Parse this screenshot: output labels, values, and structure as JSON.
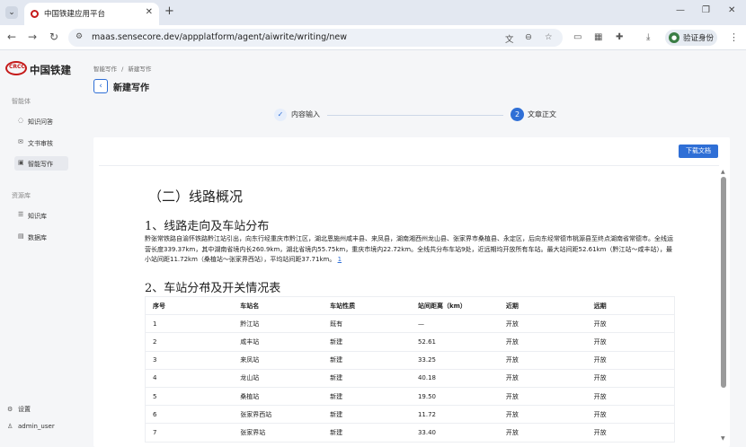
{
  "browser": {
    "tab_title": "中国铁建应用平台",
    "url": "maas.sensecore.dev/appplatform/agent/aiwrite/writing/new",
    "verify_label": "验证身份"
  },
  "sidebar": {
    "logo_text": "中国铁建",
    "logo_mark": "CRCC",
    "section1": "智能体",
    "items1": [
      {
        "label": "知识问答",
        "icon": "chat-icon"
      },
      {
        "label": "文书审核",
        "icon": "mail-icon"
      },
      {
        "label": "智能写作",
        "icon": "edit-icon"
      }
    ],
    "section2": "资源库",
    "items2": [
      {
        "label": "知识库",
        "icon": "list-icon"
      },
      {
        "label": "数据库",
        "icon": "doc-icon"
      }
    ],
    "settings_label": "设置",
    "user_label": "admin_user"
  },
  "header": {
    "breadcrumb_root": "智能写作",
    "breadcrumb_sep": "/",
    "breadcrumb_current": "新建写作",
    "title": "新建写作"
  },
  "stepper": {
    "step1_label": "内容输入",
    "step2_number": "2",
    "step2_label": "文章正文"
  },
  "toolbar": {
    "download_label": "下载文档"
  },
  "document": {
    "section_heading": "（二）线路概况",
    "heading1": "1、线路走向及车站分布",
    "paragraph": "黔张常铁路自渝怀铁路黔江站引出，向东行经重庆市黔江区，湖北恩施州咸丰县、来凤县，湖南湘西州龙山县、张家界市桑植县、永定区，后向东经常德市桃源县至终点湖南省常德市。全线运营长度339.37km，其中湖南省境内长260.9km，湖北省境内55.75km，重庆市境内22.72km。全线共分布车站9处，近远期均开放所有车站。最大站间距52.61km（黔江站～咸丰站），最小站间距11.72km（桑植站～张家界西站），平均站间距37.71km。",
    "paragraph_ref": "1",
    "heading2": "2、车站分布及开关情况表",
    "table": {
      "headers": [
        "序号",
        "车站名",
        "车站性质",
        "站间距离（km）",
        "近期",
        "远期"
      ],
      "rows": [
        [
          "1",
          "黔江站",
          "既有",
          "—",
          "开放",
          "开放"
        ],
        [
          "2",
          "咸丰站",
          "新建",
          "52.61",
          "开放",
          "开放"
        ],
        [
          "3",
          "来凤站",
          "新建",
          "33.25",
          "开放",
          "开放"
        ],
        [
          "4",
          "龙山站",
          "新建",
          "40.18",
          "开放",
          "开放"
        ],
        [
          "5",
          "桑植站",
          "新建",
          "19.50",
          "开放",
          "开放"
        ],
        [
          "6",
          "张家界西站",
          "新建",
          "11.72",
          "开放",
          "开放"
        ],
        [
          "7",
          "张家界站",
          "新建",
          "33.40",
          "开放",
          "开放"
        ]
      ]
    }
  },
  "colors": {
    "accent": "#2f6fd6",
    "brand_red": "#c51a1a"
  }
}
